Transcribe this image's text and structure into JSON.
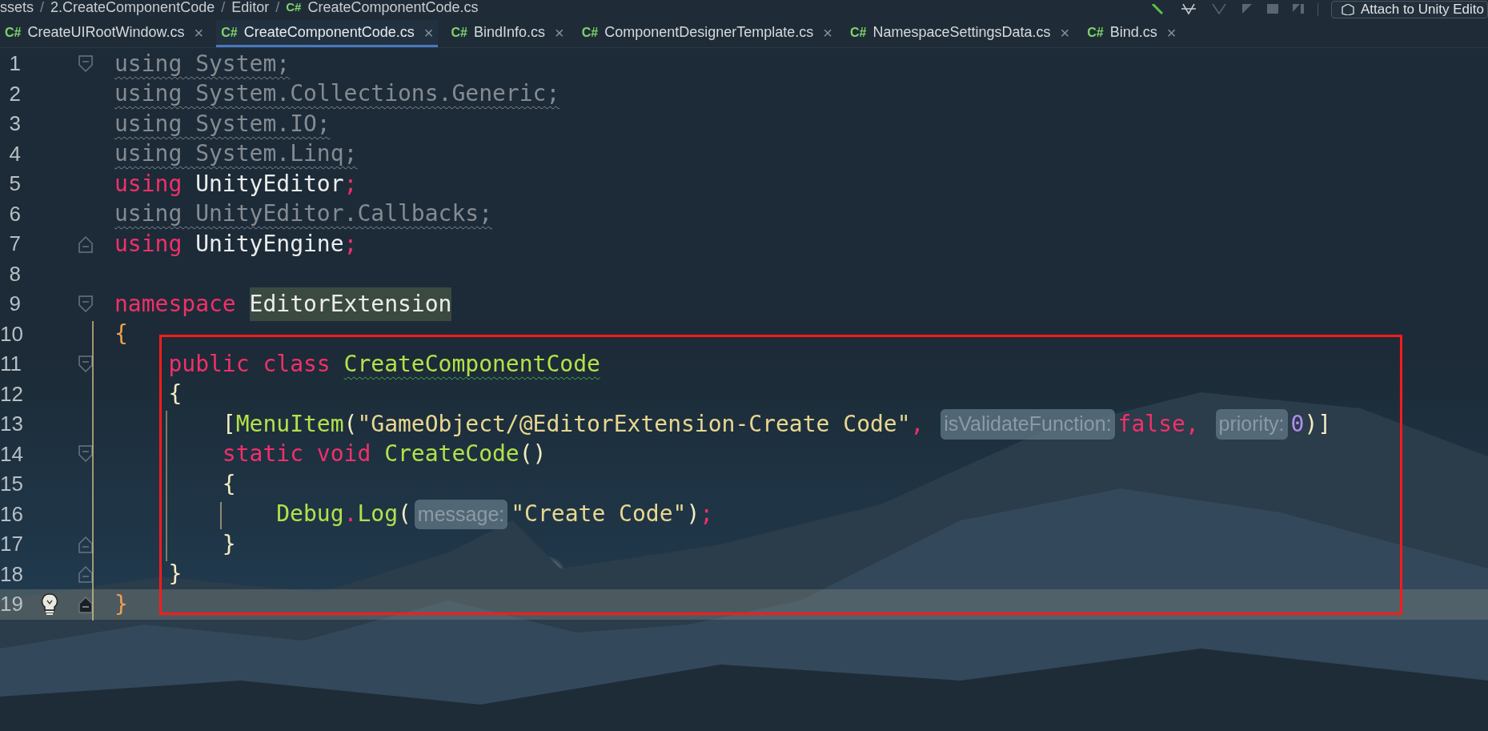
{
  "breadcrumb": {
    "separator": "/",
    "items": [
      {
        "label": "ssets"
      },
      {
        "label": "2.CreateComponentCode"
      },
      {
        "label": "Editor"
      },
      {
        "label": "CreateComponentCode.cs",
        "badge": "C#"
      }
    ]
  },
  "toolbar": {
    "attach_button": "Attach to Unity Edito"
  },
  "tabs": [
    {
      "badge": "C#",
      "label": "CreateUIRootWindow.cs",
      "close": "×",
      "selected": false
    },
    {
      "badge": "C#",
      "label": "CreateComponentCode.cs",
      "close": "×",
      "selected": true
    },
    {
      "badge": "C#",
      "label": "BindInfo.cs",
      "close": "×",
      "selected": false
    },
    {
      "badge": "C#",
      "label": "ComponentDesignerTemplate.cs",
      "close": "×",
      "selected": false
    },
    {
      "badge": "C#",
      "label": "NamespaceSettingsData.cs",
      "close": "×",
      "selected": false
    },
    {
      "badge": "C#",
      "label": "Bind.cs",
      "close": "×",
      "selected": false
    }
  ],
  "editor": {
    "lines": [
      {
        "number": "1",
        "kind": "fold-start",
        "current": false,
        "tokens": [
          {
            "kind": "unused",
            "text": "using System;"
          }
        ]
      },
      {
        "number": "2",
        "current": false,
        "tokens": [
          {
            "kind": "unused",
            "text": "using System.Collections.Generic;"
          }
        ]
      },
      {
        "number": "3",
        "current": false,
        "tokens": [
          {
            "kind": "unused",
            "text": "using System.IO;"
          }
        ]
      },
      {
        "number": "4",
        "current": false,
        "tokens": [
          {
            "kind": "unused",
            "text": "using System.Linq;"
          }
        ]
      },
      {
        "number": "5",
        "current": false,
        "tokens": [
          {
            "kind": "keyword",
            "text": "using"
          },
          {
            "kind": "plain",
            "text": " UnityEditor"
          },
          {
            "kind": "punct",
            "text": ";"
          }
        ]
      },
      {
        "number": "6",
        "current": false,
        "tokens": [
          {
            "kind": "unused",
            "text": "using UnityEditor.Callbacks;"
          }
        ]
      },
      {
        "number": "7",
        "kind": "fold-end",
        "current": false,
        "tokens": [
          {
            "kind": "keyword",
            "text": "using"
          },
          {
            "kind": "plain",
            "text": " UnityEngine"
          },
          {
            "kind": "punct",
            "text": ";"
          }
        ]
      },
      {
        "number": "8",
        "current": false
      },
      {
        "number": "9",
        "kind": "fold-start",
        "current": false,
        "tokens": [
          {
            "kind": "keyword",
            "text": "namespace "
          },
          {
            "kind": "highlighted",
            "text": "EditorExtension"
          }
        ]
      },
      {
        "number": "10",
        "current": false,
        "tokens": [
          {
            "kind": "outer-brace",
            "text": "{"
          }
        ],
        "children": [
          {
            "number": "11",
            "kind": "fold-start",
            "current": false,
            "tokens": [
              {
                "kind": "keyword",
                "text": "public class "
              },
              {
                "kind": "class-warning",
                "text": "CreateComponentCode"
              }
            ]
          },
          {
            "number": "12",
            "current": false,
            "tokens": [
              {
                "kind": "brace",
                "text": "{"
              }
            ],
            "children": [
              {
                "number": "13",
                "current": false,
                "tokens": [
                  {
                    "kind": "brace",
                    "text": "["
                  },
                  {
                    "kind": "method",
                    "text": "MenuItem"
                  },
                  {
                    "kind": "brace",
                    "text": "("
                  },
                  {
                    "kind": "string",
                    "text": "\"GameObject/@EditorExtension-Create Code\""
                  },
                  {
                    "kind": "punct",
                    "text": ","
                  },
                  {
                    "kind": "hint",
                    "text": "isValidateFunction:"
                  },
                  {
                    "kind": "keyword",
                    "text": "false"
                  },
                  {
                    "kind": "punct",
                    "text": ","
                  },
                  {
                    "kind": "hint",
                    "text": "priority:"
                  },
                  {
                    "kind": "number",
                    "text": "0"
                  },
                  {
                    "kind": "brace",
                    "text": ")]"
                  }
                ]
              },
              {
                "number": "14",
                "kind": "fold-start",
                "current": false,
                "tokens": [
                  {
                    "kind": "keyword",
                    "text": "static void "
                  },
                  {
                    "kind": "method",
                    "text": "CreateCode"
                  },
                  {
                    "kind": "brace",
                    "text": "()"
                  }
                ]
              },
              {
                "number": "15",
                "current": false,
                "tokens": [
                  {
                    "kind": "brace",
                    "text": "{"
                  }
                ],
                "children": [
                  {
                    "number": "16",
                    "current": false,
                    "tokens": [
                      {
                        "kind": "method",
                        "text": "Debug"
                      },
                      {
                        "kind": "punct",
                        "text": "."
                      },
                      {
                        "kind": "method",
                        "text": "Log"
                      },
                      {
                        "kind": "brace",
                        "text": "("
                      },
                      {
                        "kind": "hint",
                        "text": "message:"
                      },
                      {
                        "kind": "string",
                        "text": "\"Create Code\""
                      },
                      {
                        "kind": "brace",
                        "text": ")"
                      },
                      {
                        "kind": "punct",
                        "text": ";"
                      }
                    ]
                  }
                ]
              },
              {
                "number": "17",
                "kind": "fold-end",
                "current": false,
                "tokens": [
                  {
                    "kind": "brace",
                    "text": "}"
                  }
                ]
              }
            ]
          },
          {
            "number": "18",
            "kind": "fold-end",
            "current": false,
            "tokens": [
              {
                "kind": "brace",
                "text": "}"
              }
            ]
          }
        ]
      },
      {
        "number": "19",
        "kind": "fold-close",
        "current": true,
        "tokens": [
          {
            "kind": "outer-brace",
            "text": "}"
          }
        ]
      }
    ]
  }
}
